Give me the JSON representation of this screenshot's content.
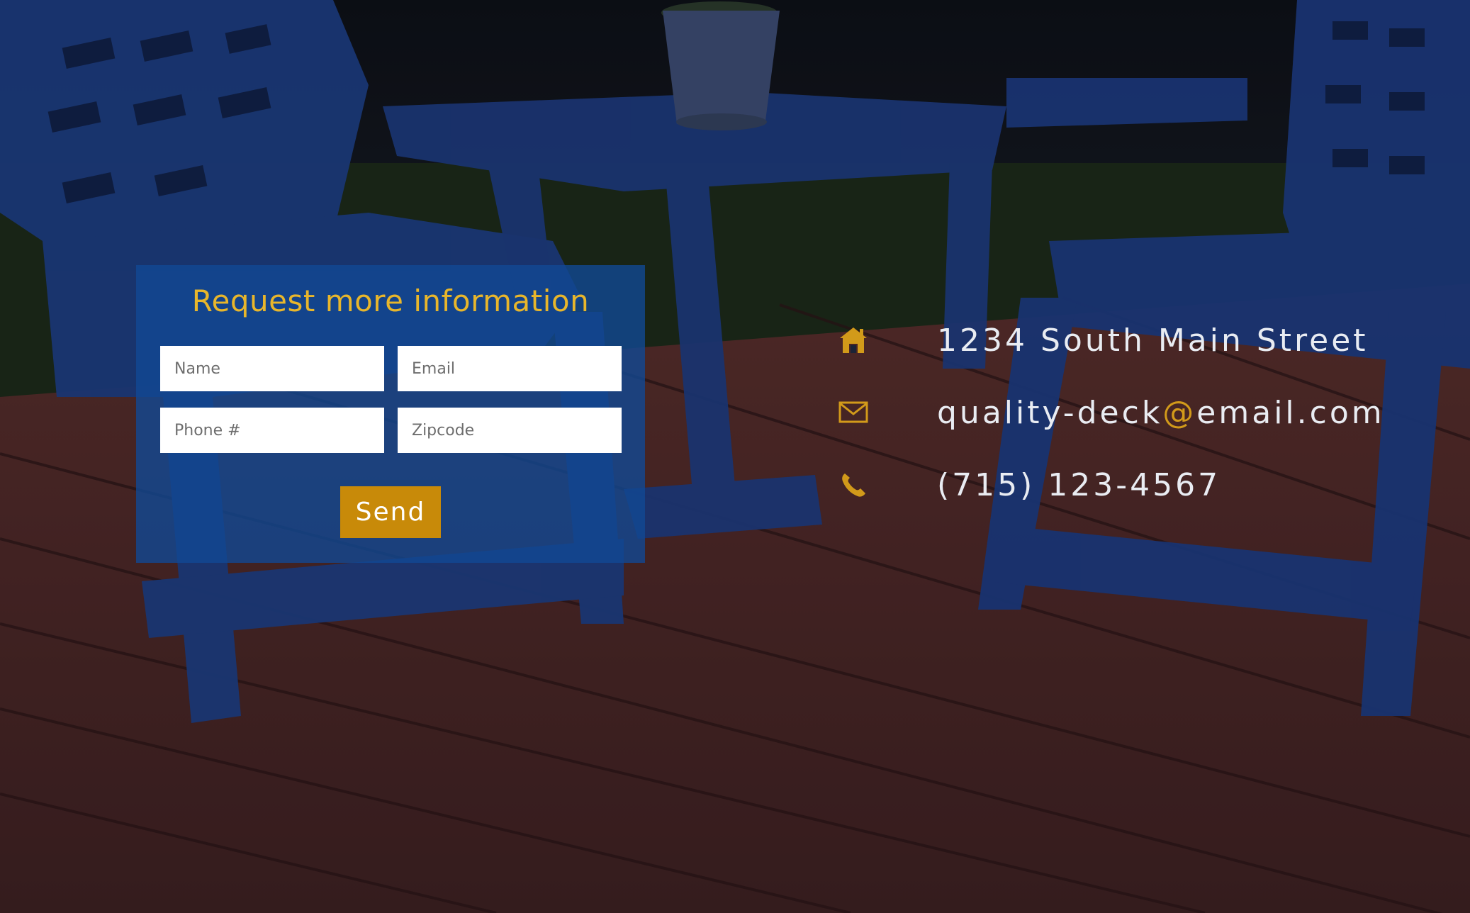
{
  "form": {
    "title": "Request more information",
    "fields": {
      "name_placeholder": "Name",
      "email_placeholder": "Email",
      "phone_placeholder": "Phone #",
      "zipcode_placeholder": "Zipcode"
    },
    "send_label": "Send"
  },
  "contact": {
    "address": "1234 South Main Street",
    "email_user": "quality-deck",
    "email_at": "@",
    "email_domain": "email.com",
    "phone": "(715) 123-4567",
    "icons": {
      "address": "home-icon",
      "email": "envelope-icon",
      "phone": "phone-icon"
    }
  },
  "colors": {
    "accent": "#c88a09",
    "title": "#e8b62b",
    "panel": "#12489a",
    "text": "#e9ecf2"
  }
}
